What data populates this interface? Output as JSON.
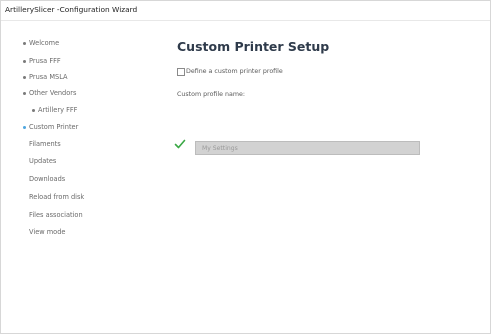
{
  "window": {
    "title": "ArtillerySlicer -Configuration Wizard"
  },
  "sidebar": {
    "items": [
      {
        "label": "Welcome",
        "bullet": true,
        "active": false
      },
      {
        "label": "Prusa FFF",
        "bullet": true,
        "active": false
      },
      {
        "label": "Prusa MSLA",
        "bullet": true,
        "active": false
      },
      {
        "label": "Other Vendors",
        "bullet": true,
        "active": false
      },
      {
        "label": "Artillery FFF",
        "bullet": true,
        "active": false,
        "sub": true
      },
      {
        "label": "Custom Printer",
        "bullet": true,
        "active": true
      },
      {
        "label": "Filaments",
        "bullet": false,
        "active": false
      },
      {
        "label": "Updates",
        "bullet": false,
        "active": false
      },
      {
        "label": "Downloads",
        "bullet": false,
        "active": false
      },
      {
        "label": "Reload from disk",
        "bullet": false,
        "active": false
      },
      {
        "label": "Files association",
        "bullet": false,
        "active": false
      },
      {
        "label": "View mode",
        "bullet": false,
        "active": false
      }
    ]
  },
  "main": {
    "title": "Custom Printer Setup",
    "define_checkbox_label": "Define a custom printer profile",
    "define_checked": false,
    "profile_name_label": "Custom profile name:",
    "profile_name_placeholder": "My Settings",
    "profile_name_value": "",
    "valid_icon": "check-icon"
  },
  "colors": {
    "title": "#2f3b4b",
    "active_bullet": "#4ea6df",
    "check": "#3aa845",
    "input_bg": "#d2d2d2"
  }
}
